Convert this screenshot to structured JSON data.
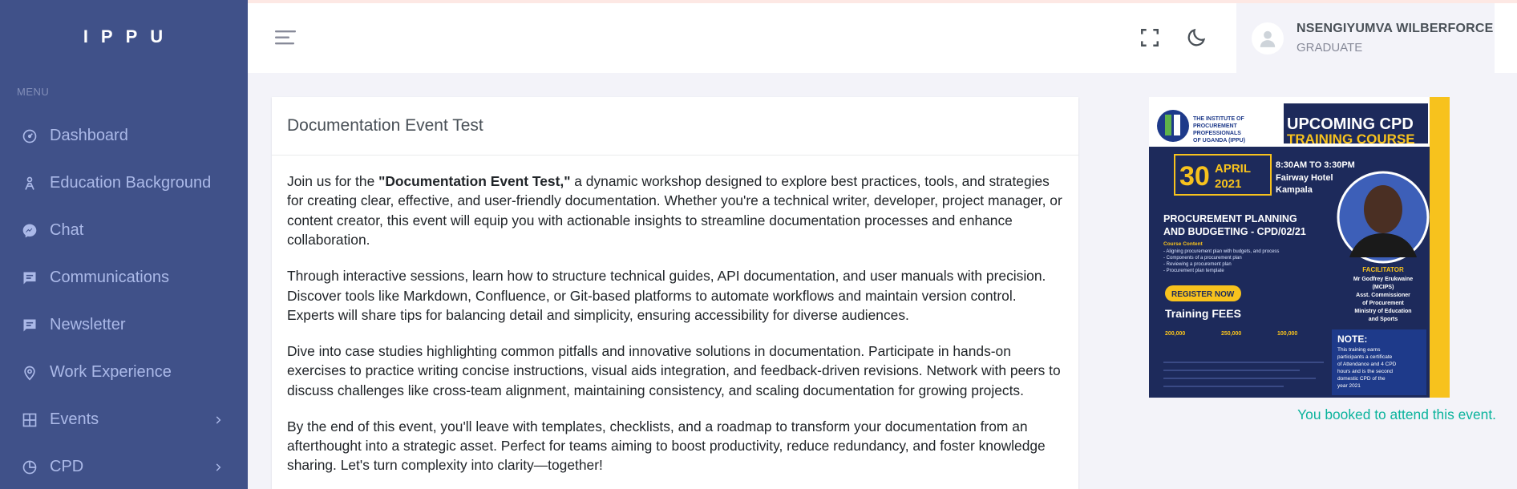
{
  "brand": {
    "name": "IPPU"
  },
  "sidebar": {
    "menu_title": "MENU",
    "items": [
      {
        "label": "Dashboard",
        "icon": "dashboard-icon"
      },
      {
        "label": "Education Background",
        "icon": "education-icon"
      },
      {
        "label": "Chat",
        "icon": "messenger-icon"
      },
      {
        "label": "Communications",
        "icon": "message-icon"
      },
      {
        "label": "Newsletter",
        "icon": "message-icon"
      },
      {
        "label": "Work Experience",
        "icon": "map-pin-icon"
      },
      {
        "label": "Events",
        "icon": "grid-icon",
        "has_submenu": true
      },
      {
        "label": "CPD",
        "icon": "pie-chart-icon",
        "has_submenu": true
      }
    ]
  },
  "topbar": {
    "user_name": "NSENGIYUMVA WILBERFORCE",
    "user_role": "GRADUATE"
  },
  "event": {
    "title": "Documentation Event Test",
    "p1_pre": "Join us for the ",
    "p1_bold": "\"Documentation Event Test,\"",
    "p1_post": " a dynamic workshop designed to explore best practices, tools, and strategies for creating clear, effective, and user-friendly documentation. Whether you're a technical writer, developer, project manager, or content creator, this event will equip you with actionable insights to streamline documentation processes and enhance collaboration.",
    "p2": "Through interactive sessions, learn how to structure technical guides, API documentation, and user manuals with precision. Discover tools like Markdown, Confluence, or Git-based platforms to automate workflows and maintain version control. Experts will share tips for balancing detail and simplicity, ensuring accessibility for diverse audiences.",
    "p3": "Dive into case studies highlighting common pitfalls and innovative solutions in documentation. Participate in hands-on exercises to practice writing concise instructions, visual aids integration, and feedback-driven revisions. Network with peers to discuss challenges like cross-team alignment, maintaining consistency, and scaling documentation for growing projects.",
    "p4": "By the end of this event, you'll leave with templates, checklists, and a roadmap to transform your documentation from an afterthought into a strategic asset. Perfect for teams aiming to boost productivity, reduce redundancy, and foster knowledge sharing. Let's turn complexity into clarity—together!",
    "booking_status": "You booked to attend this event."
  },
  "poster": {
    "org_line1": "THE INSTITUTE OF",
    "org_line2": "PROCUREMENT",
    "org_line3": "PROFESSIONALS",
    "org_line4": "OF UGANDA (IPPU)",
    "headline1": "UPCOMING CPD",
    "headline2": "TRAINING COURSE",
    "day": "30",
    "month": "APRIL",
    "year": "2021",
    "time": "8:30AM TO 3:30PM",
    "venue1": "Fairway Hotel",
    "venue2": "Kampala",
    "course1": "PROCUREMENT PLANNING",
    "course2": "AND BUDGETING - CPD/02/21",
    "content_title": "Course Content",
    "content1": "- Aligning procurement plan with budgets, and process",
    "content2": "- Components of a procurement plan",
    "content3": "- Reviewing a procurement plan",
    "content4": "- Procurement plan template",
    "register": "REGISTER NOW",
    "fees": "Training FEES",
    "fee1": "200,000",
    "fee2": "250,000",
    "fee3": "100,000",
    "facilitator_title": "FACILITATOR",
    "facilitator_name": "Mr Godfrey Erukwaine",
    "facilitator_cred": "(MCIPS)",
    "facilitator_role1": "Asst. Commissioner",
    "facilitator_role2": "of Procurement",
    "facilitator_role3": "Ministry of Education",
    "facilitator_role4": "and Sports",
    "note_title": "NOTE:",
    "note1": "This training earns",
    "note2": "participants a certificate",
    "note3": "of Attendance and 4 CPD",
    "note4": "hours and is the second",
    "note5": "domestic CPD of the",
    "note6": "year 2021",
    "colors": {
      "navy": "#1d2a5b",
      "yellow": "#f7c21d",
      "blue": "#1e3a8a"
    }
  },
  "colors": {
    "sidebar": "#405189",
    "accent_green": "#0ab39c",
    "page_bg": "#f3f3f9"
  }
}
